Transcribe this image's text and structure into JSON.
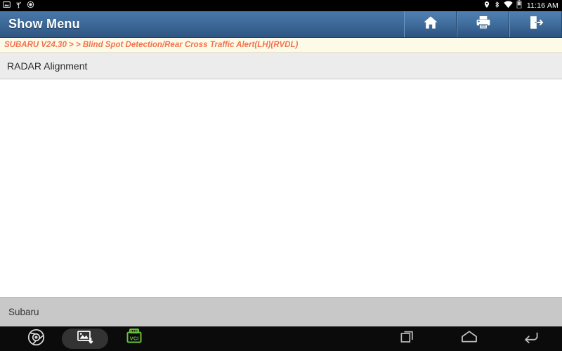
{
  "statusbar": {
    "left_icons": [
      "screenshot-icon",
      "usb-icon",
      "debug-icon"
    ],
    "right_icons": [
      "location-pin-icon",
      "bluetooth-icon",
      "wifi-icon",
      "battery-icon"
    ],
    "time": "11:16 AM"
  },
  "titlebar": {
    "title": "Show Menu",
    "buttons": [
      {
        "name": "home-button",
        "icon": "home-icon"
      },
      {
        "name": "print-button",
        "icon": "printer-icon"
      },
      {
        "name": "exit-button",
        "icon": "exit-door-icon"
      }
    ]
  },
  "breadcrumb": {
    "text": "SUBARU V24.30 >  > Blind Spot Detection/Rear Cross Traffic Alert(LH)(RVDL)"
  },
  "menu": {
    "items": [
      {
        "label": "RADAR Alignment"
      }
    ]
  },
  "footer": {
    "vehicle": "Subaru"
  },
  "navbar": {
    "left_items": [
      {
        "name": "chrome-icon",
        "label": ""
      },
      {
        "name": "screenshot-capture-icon",
        "label": ""
      },
      {
        "name": "vci-icon",
        "label": "VCI"
      }
    ],
    "right_items": [
      {
        "name": "recents-button",
        "icon": "recents-icon"
      },
      {
        "name": "home-nav-button",
        "icon": "home-outline-icon"
      },
      {
        "name": "back-button",
        "icon": "back-arrow-icon"
      }
    ]
  },
  "colors": {
    "title_blue": "#3d6a9a",
    "breadcrumb_bg": "#fdfbe8",
    "breadcrumb_text": "#f4714e",
    "row_bg": "#ececec",
    "footer_bg": "#c8c8c8",
    "vci_green": "#6abf3a"
  }
}
